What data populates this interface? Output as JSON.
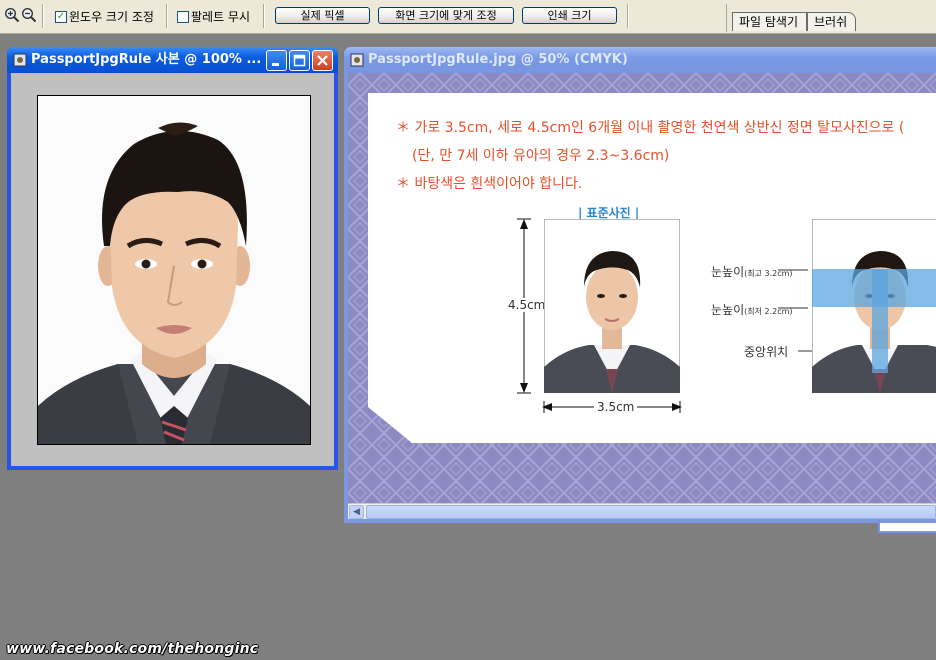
{
  "toolbar": {
    "zoom_in_icon": "zoom-in-icon",
    "zoom_out_icon": "zoom-out-icon",
    "resize_windows_label": "윈도우 크기 조정",
    "resize_windows_checked": true,
    "ignore_palettes_label": "팔레트 무시",
    "ignore_palettes_checked": false,
    "actual_pixels_label": "실제 픽셀",
    "fit_screen_label": "화면 크기에 맞게 조정",
    "print_size_label": "인쇄 크기"
  },
  "palette_well": {
    "tabs": [
      {
        "label": "파일 탐색기"
      },
      {
        "label": "브러쉬"
      }
    ]
  },
  "window_left": {
    "title": "PassportJpgRule 사본 @ 100% ...",
    "active": true,
    "buttons": [
      "minimize",
      "maximize",
      "close"
    ]
  },
  "window_right": {
    "title": "PassportJpgRule.jpg @ 50% (CMYK)",
    "active": false,
    "doc": {
      "line1": "＊ 가로 3.5cm, 세로 4.5cm인 6개월 이내 촬영한 천연색 상반신 정면 탈모사진으로 (",
      "line2": "(단, 만 7세 이하 유아의 경우 2.3~3.6cm)",
      "line3": "＊ 바탕색은 흰색이어야 합니다.",
      "standard_label": "| 표준사진 |",
      "height_label": "4.5cm",
      "width_label": "3.5cm",
      "eye_max_label": "눈높이",
      "eye_max_note": "(최고 3.2cm)",
      "eye_min_label": "눈높이",
      "eye_min_note": "(최저 2.2cm)",
      "center_label": "중앙위치"
    }
  },
  "watermark": "www.facebook.com/thehonginc",
  "colors": {
    "desktop": "#7f7f7f",
    "toolbar": "#ece9d8",
    "title_active": "#0a5be0",
    "title_inactive": "#7a9ae5",
    "doc_red": "#e65029",
    "doc_blue": "#2a86cc",
    "doc_bg": "#8d8ac4"
  }
}
